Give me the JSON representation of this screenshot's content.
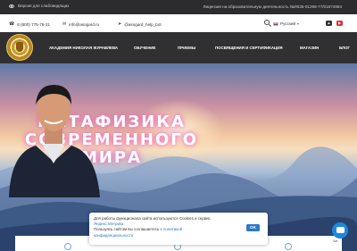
{
  "topbar": {
    "accessible_label": "Версия для слабовидящих",
    "license_text": "Лицензия на образовательную деятельность №Л035-01298-77/01874694"
  },
  "contact": {
    "phone": "8 (800) 775-78-31",
    "email": "info@asogard.ru",
    "telegram": "@asogard_help_bot",
    "language": "Русский"
  },
  "nav": {
    "items": [
      "АКАДЕМИЯ НИКОЛАЯ ЖУРАВЛЕВА",
      "ОБУЧЕНИЕ",
      "ПРИЕМЫ",
      "ПОСВЯЩЕНИЯ И СЕРТИФИКАЦИЯ",
      "МАГАЗИН",
      "БЛОГ"
    ]
  },
  "hero": {
    "title_lines": [
      "МЕТАФИЗИКА",
      "СОВРЕМЕННОГО",
      "МИРА"
    ]
  },
  "cookie": {
    "line1": "Для работы функционала сайта используются Cookies и сервис",
    "metrika_link": "Яндекс.Метрика",
    "line2": "Пользуясь сайтом вы соглашаетесь с",
    "policy_link": "политикой",
    "policy_link_2": "конфиденциальности",
    "ok_label": "OK"
  },
  "chat": {
    "label": "Чат"
  },
  "colors": {
    "topbar_bg": "#2c2c2e",
    "nav_bg": "#303033",
    "accent_blue": "#2d79c7",
    "title_glow": "#e064c8"
  },
  "icons": [
    "eye-icon",
    "phone-icon",
    "mail-icon",
    "telegram-icon",
    "search-icon",
    "flag-ru-icon",
    "vk-icon",
    "youtube-icon",
    "chat-icon"
  ]
}
